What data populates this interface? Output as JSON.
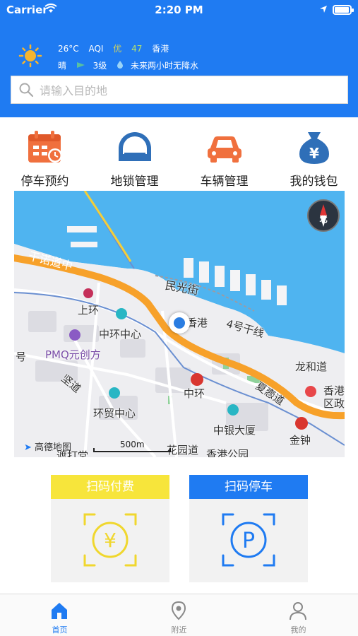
{
  "status_bar": {
    "carrier": "Carrier",
    "time": "2:20 PM",
    "battery_level": 0.95
  },
  "weather": {
    "icon": "sun-icon",
    "temperature": "26°C",
    "aqi_label": "AQI",
    "aqi_quality": "优",
    "aqi_value": "47",
    "city": "香港",
    "condition": "晴",
    "wind_icon": "wind-flag-icon",
    "wind_level": "3级",
    "rain_icon": "raindrop-icon",
    "forecast": "未来两小时无降水"
  },
  "search": {
    "placeholder": "请输入目的地"
  },
  "menu": [
    {
      "label": "停车预约",
      "icon": "calendar-clock-icon",
      "color": "#f0703e"
    },
    {
      "label": "地锁管理",
      "icon": "parking-lock-icon",
      "color": "#2f6fb8"
    },
    {
      "label": "车辆管理",
      "icon": "car-icon",
      "color": "#f0703e"
    },
    {
      "label": "我的钱包",
      "icon": "money-bag-icon",
      "color": "#2f6fb8"
    }
  ],
  "map": {
    "labels": {
      "road1": "干诺道中",
      "minguang": "民光街",
      "shanghuan": "上环",
      "zhonghuan_center": "中环中心",
      "xianggang": "香港",
      "road4": "4号干线",
      "pmq": "PMQ元创方",
      "hao": "号",
      "longhedao": "龙和道",
      "jian": "坚道",
      "zhonghuan": "中环",
      "xiaqu": "夏悫道",
      "hk_district": "香港",
      "district2": "区政",
      "huanmao": "环贸中心",
      "bank_building": "中银大厦",
      "jinzhong": "金钟",
      "park": "香港公园",
      "amap": "高德地图",
      "dali": "遮打堂",
      "gardens": "花园道"
    },
    "compass_label": "北",
    "scale": "500m"
  },
  "actions": [
    {
      "label": "扫码付费",
      "color": "#f7e53b",
      "icon": "yuan-scan-icon"
    },
    {
      "label": "扫码停车",
      "color": "#1f7bf2",
      "icon": "parking-scan-icon"
    }
  ],
  "tabs": [
    {
      "label": "首页",
      "icon": "home-icon",
      "active": true
    },
    {
      "label": "附近",
      "icon": "location-pin-icon",
      "active": false
    },
    {
      "label": "我的",
      "icon": "user-icon",
      "active": false
    }
  ]
}
